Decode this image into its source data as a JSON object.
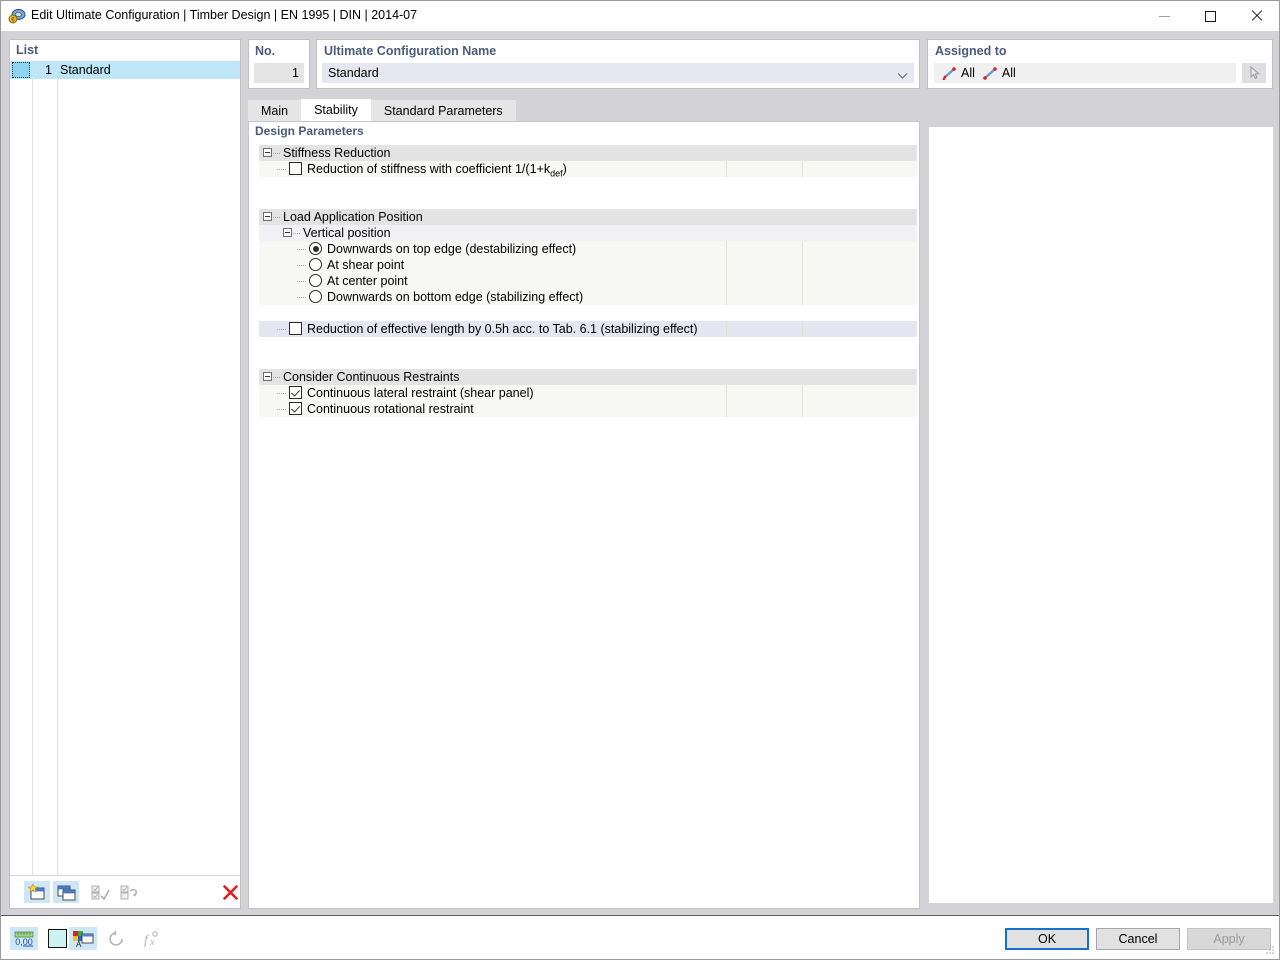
{
  "window": {
    "title": "Edit Ultimate Configuration | Timber Design | EN 1995 | DIN | 2014-07",
    "icon": "app-icon",
    "minimize": "minimize-icon",
    "maximize": "maximize-icon",
    "close": "close-icon"
  },
  "list": {
    "header": "List",
    "rows": [
      {
        "no": "1",
        "name": "Standard"
      }
    ],
    "toolbar": [
      {
        "name": "new-configuration-button",
        "enabled": true
      },
      {
        "name": "copy-configuration-button",
        "enabled": true
      },
      {
        "name": "check-configuration-button",
        "enabled": false
      },
      {
        "name": "exchange-configuration-button",
        "enabled": false
      },
      {
        "name": "delete-configuration-button",
        "enabled": true
      }
    ]
  },
  "number_field": {
    "label": "No.",
    "value": "1"
  },
  "name_field": {
    "label": "Ultimate Configuration Name",
    "value": "Standard",
    "arrow": "chevron-down-icon"
  },
  "assigned_to": {
    "label": "Assigned to",
    "items": [
      {
        "icon": "members-icon",
        "label": "All"
      },
      {
        "icon": "member-sets-icon",
        "label": "All"
      }
    ],
    "pick_button": "select-in-graphic-button"
  },
  "tabs": [
    {
      "label": "Main",
      "active": false
    },
    {
      "label": "Stability",
      "active": true
    },
    {
      "label": "Standard Parameters",
      "active": false
    }
  ],
  "design_parameters": {
    "header": "Design Parameters",
    "rows": [
      {
        "kind": "group",
        "label": "Stiffness Reduction",
        "indent": 0
      },
      {
        "kind": "check",
        "label": "Reduction of stiffness with coefficient 1/(1+k",
        "sub": "def",
        "suffix": ")",
        "checked": false,
        "indent": 1
      },
      {
        "kind": "blank"
      },
      {
        "kind": "group",
        "label": "Load Application Position",
        "indent": 0
      },
      {
        "kind": "subgroup",
        "label": "Vertical position",
        "indent": 1
      },
      {
        "kind": "radio",
        "label": "Downwards on top edge (destabilizing effect)",
        "selected": true,
        "indent": 2
      },
      {
        "kind": "radio",
        "label": "At shear point",
        "selected": false,
        "indent": 2
      },
      {
        "kind": "radio",
        "label": "At center point",
        "selected": false,
        "indent": 2
      },
      {
        "kind": "radio",
        "label": "Downwards on bottom edge (stabilizing effect)",
        "selected": false,
        "indent": 2
      },
      {
        "kind": "blank"
      },
      {
        "kind": "check-alt",
        "label": "Reduction of effective length by 0.5h acc. to Tab. 6.1 (stabilizing effect)",
        "checked": false,
        "indent": 1
      },
      {
        "kind": "blank"
      },
      {
        "kind": "group",
        "label": "Consider Continuous Restraints",
        "indent": 0
      },
      {
        "kind": "check",
        "label": "Continuous lateral restraint (shear panel)",
        "checked": true,
        "indent": 1
      },
      {
        "kind": "check",
        "label": "Continuous rotational restraint",
        "checked": true,
        "indent": 1
      }
    ]
  },
  "status_bar": {
    "buttons": [
      {
        "name": "decimal-places-button",
        "enabled": true,
        "active": true
      },
      {
        "name": "color-swatch-button",
        "enabled": true,
        "active": false
      },
      {
        "name": "display-properties-button",
        "enabled": true,
        "active": true
      },
      {
        "name": "reset-button",
        "enabled": false,
        "active": false
      },
      {
        "name": "formula-button",
        "enabled": false,
        "active": false
      }
    ]
  },
  "dialog_buttons": {
    "ok": "OK",
    "cancel": "Cancel",
    "apply": "Apply"
  },
  "colors": {
    "accent_header": "#4a5b7a",
    "selection": "#bfe6f7",
    "focus_border": "#1572c8",
    "group_row": "#e3e3e3",
    "item_row": "#f7f8f3",
    "alt_row": "#e6e6f2"
  }
}
